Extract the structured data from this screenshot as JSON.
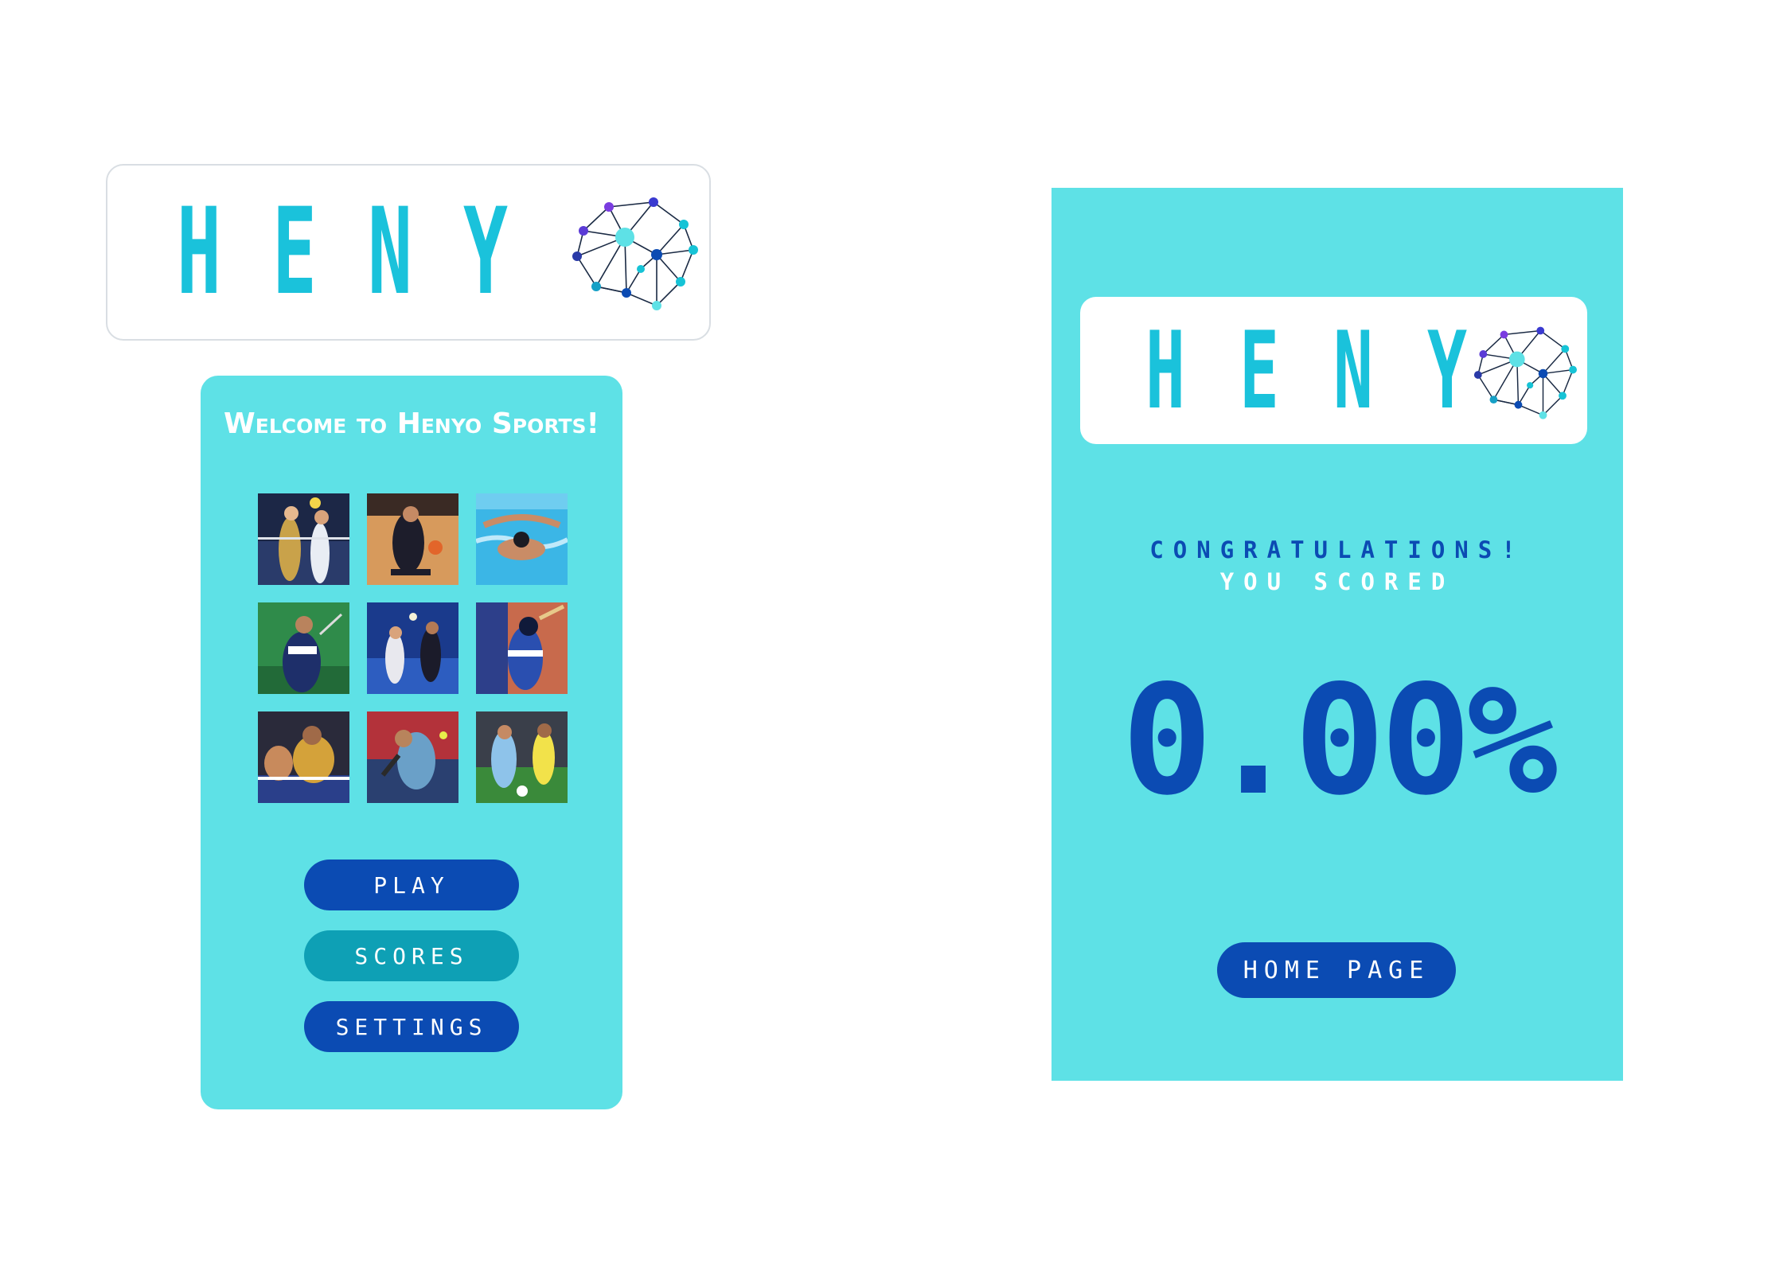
{
  "brand": {
    "logo_letters": [
      "H",
      "E",
      "N",
      "Y"
    ],
    "logo_color": "#1ac2db",
    "icon": "brain-network-icon"
  },
  "home_screen": {
    "welcome_text": "Welcome to Henyo Sports!",
    "background": "#5ee1e6",
    "sport_images": [
      {
        "icon": "volleyball-photo"
      },
      {
        "icon": "basketball-photo"
      },
      {
        "icon": "swimming-photo"
      },
      {
        "icon": "badminton-photo"
      },
      {
        "icon": "indoor-volleyball-photo"
      },
      {
        "icon": "baseball-photo"
      },
      {
        "icon": "table-tennis-photo"
      },
      {
        "icon": "tennis-photo"
      },
      {
        "icon": "soccer-photo"
      }
    ],
    "buttons": {
      "play": "PLAY",
      "scores": "SCORES",
      "settings": "SETTINGS"
    }
  },
  "result_screen": {
    "congrats_text": "CONGRATULATIONS!",
    "scored_text": "YOU SCORED",
    "score": "0.00%",
    "home_button": "HOME PAGE"
  },
  "colors": {
    "primary": "#0b4bb3",
    "secondary": "#0ea0b5",
    "panel": "#5ee1e6"
  }
}
